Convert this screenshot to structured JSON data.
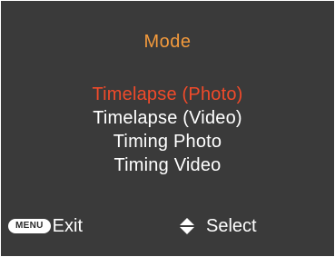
{
  "screen": {
    "title": "Mode",
    "title_color": "#f39a3c",
    "selected_color": "#f04a2a",
    "background": "#3a3a3a"
  },
  "menu": {
    "items": [
      {
        "label": "Timelapse (Photo)",
        "selected": true
      },
      {
        "label": "Timelapse (Video)",
        "selected": false
      },
      {
        "label": "Timing Photo",
        "selected": false
      },
      {
        "label": "Timing Video",
        "selected": false
      }
    ]
  },
  "footer": {
    "menu_badge": "MENU",
    "exit_label": "Exit",
    "navigate_icon": "up-down-triangle-icon",
    "select_label": "Select"
  }
}
